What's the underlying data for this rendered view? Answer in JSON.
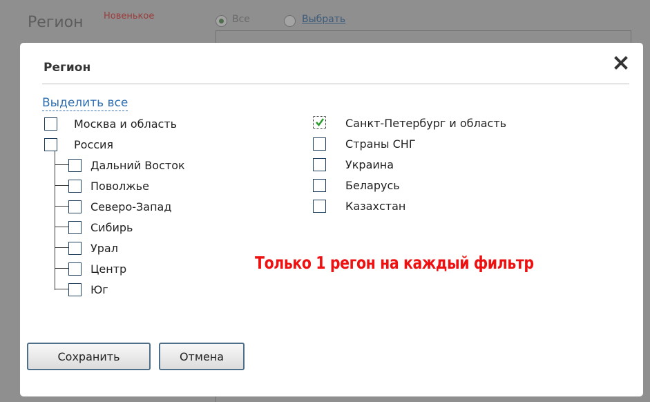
{
  "background": {
    "field_label": "Регион",
    "new_badge": "Новенькое",
    "radio_all_label": "Все",
    "radio_choose_label": "Выбрать",
    "selected_radio": "all"
  },
  "dialog": {
    "title": "Регион",
    "close_icon": "close-x-icon",
    "select_all_label": "Выделить все",
    "left_column": [
      {
        "label": "Москва и область",
        "checked": false
      },
      {
        "label": "Россия",
        "checked": false,
        "children": [
          {
            "label": "Дальний Восток",
            "checked": false
          },
          {
            "label": "Поволжье",
            "checked": false
          },
          {
            "label": "Северо-Запад",
            "checked": false
          },
          {
            "label": "Сибирь",
            "checked": false
          },
          {
            "label": "Урал",
            "checked": false
          },
          {
            "label": "Центр",
            "checked": false
          },
          {
            "label": "Юг",
            "checked": false
          }
        ]
      }
    ],
    "right_column": [
      {
        "label": "Санкт-Петербург и область",
        "checked": true
      },
      {
        "label": "Страны СНГ",
        "checked": false
      },
      {
        "label": "Украина",
        "checked": false
      },
      {
        "label": "Беларусь",
        "checked": false
      },
      {
        "label": "Казахстан",
        "checked": false
      }
    ],
    "annotation": "Только 1 регон на каждый фильтр",
    "annotation_color": "#ee1111",
    "buttons": {
      "save_label": "Сохранить",
      "cancel_label": "Отмена"
    }
  }
}
